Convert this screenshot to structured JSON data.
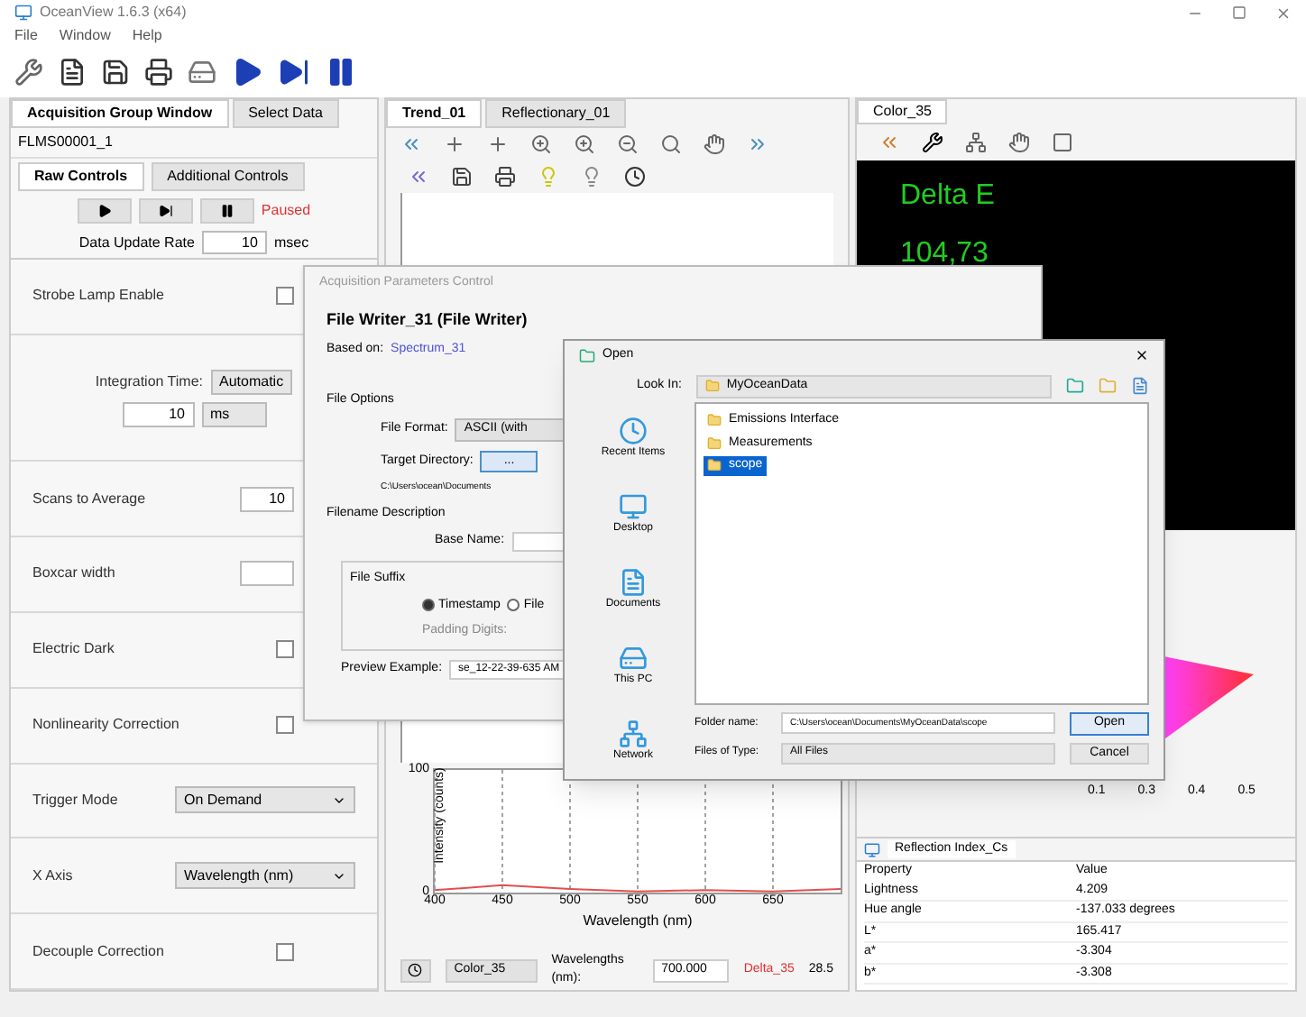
{
  "window": {
    "title": "OceanView 1.6.3 (x64)"
  },
  "menu": [
    "File",
    "Window",
    "Help"
  ],
  "left_panel": {
    "tabs": [
      {
        "label": "Acquisition Group Window",
        "selected": true
      },
      {
        "label": "Select Data",
        "selected": false
      }
    ],
    "device": "FLMS00001_1",
    "subtabs": [
      {
        "label": "Raw Controls",
        "selected": true
      },
      {
        "label": "Additional Controls",
        "selected": false
      }
    ],
    "status": "Paused",
    "update_rate": {
      "label": "Data Update Rate",
      "value": "10",
      "unit": "msec"
    },
    "rows": [
      {
        "kind": "checkbox",
        "label": "Strobe Lamp Enable",
        "checked": false
      },
      {
        "kind": "integration",
        "label": "Integration Time:",
        "mode": "Automatic",
        "value": "10",
        "unit": "ms"
      },
      {
        "kind": "spin",
        "label": "Scans to Average",
        "value": "10"
      },
      {
        "kind": "spin",
        "label": "Boxcar width"
      },
      {
        "kind": "checkbox",
        "label": "Electric Dark",
        "checked": false
      },
      {
        "kind": "checkbox",
        "label": "Nonlinearity Correction",
        "checked": false
      },
      {
        "kind": "select",
        "label": "Trigger Mode",
        "value": "On Demand"
      },
      {
        "kind": "select",
        "label": "X Axis",
        "value": "Wavelength (nm)"
      },
      {
        "kind": "checkbox",
        "label": "Decouple Correction",
        "checked": false
      }
    ]
  },
  "center_panel": {
    "tabs": [
      {
        "label": "Trend_01",
        "selected": true
      },
      {
        "label": "Reflectionary_01",
        "selected": false
      }
    ],
    "spectrum": {
      "selector": "Color_35",
      "wavelength_label": "Wavelengths (nm):",
      "wavelength_value": "700.000",
      "reading_label": "Delta_35",
      "reading_value": "28.5",
      "chart_data": {
        "type": "line",
        "xlabel": "Wavelength (nm)",
        "ylabel": "Intensity (counts)",
        "x": [
          400,
          450,
          500,
          550,
          600,
          650,
          700
        ],
        "series": [
          {
            "color": "#e05050",
            "values": [
              2,
              6,
              3,
              1,
              2,
              1,
              3
            ]
          }
        ],
        "xlim": [
          400,
          700
        ],
        "ylim": [
          0,
          100
        ],
        "xticks": [
          400,
          450,
          500,
          550,
          600,
          650
        ],
        "yticks": [
          0,
          100
        ],
        "grid": true
      }
    }
  },
  "right_panel": {
    "tab": "Color_35",
    "delta_label": "Delta E",
    "delta_value": "104,73",
    "cie_ticks": [
      "0.1",
      "0.3",
      "0.4",
      "0.5"
    ],
    "properties": {
      "tab": "Reflection Index_Cs",
      "columns": [
        "Property",
        "Value"
      ],
      "rows": [
        [
          "Lightness",
          "4.209"
        ],
        [
          "Hue angle",
          "-137.033 degrees"
        ],
        [
          "L*",
          "165.417"
        ],
        [
          "a*",
          "-3.304"
        ],
        [
          "b*",
          "-3.308"
        ]
      ]
    }
  },
  "params_dialog": {
    "title": "Acquisition Parameters Control",
    "heading": "File Writer_31 (File Writer)",
    "based_on_label": "Based on:",
    "based_on": "Spectrum_31",
    "section": "File Options",
    "file_format_label": "File Format:",
    "file_format": "ASCII (with",
    "target_label": "Target Directory:",
    "target_button": "...",
    "target_path": "C:\\Users\\ocean\\Documents",
    "filename_section": "Filename Description",
    "base_name_label": "Base Name:",
    "suffix_section": "File Suffix",
    "suffix_options": [
      {
        "label": "Timestamp",
        "selected": true
      },
      {
        "label": "File",
        "selected": false
      }
    ],
    "padding_label": "Padding Digits:",
    "preview_label": "Preview Example:",
    "preview": "se_12-22-39-635 AM"
  },
  "open_dialog": {
    "title": "Open",
    "look_in_label": "Look In:",
    "look_in": "MyOceanData",
    "places": [
      "Recent Items",
      "Desktop",
      "Documents",
      "This PC",
      "Network"
    ],
    "files": [
      {
        "name": "Emissions Interface",
        "selected": false
      },
      {
        "name": "Measurements",
        "selected": false
      },
      {
        "name": "scope",
        "selected": true
      }
    ],
    "file_name_label": "Folder name:",
    "file_name": "C:\\Users\\ocean\\Documents\\MyOceanData\\scope",
    "type_label": "Files of Type:",
    "type": "All Files",
    "buttons": [
      "Open",
      "Cancel"
    ]
  }
}
